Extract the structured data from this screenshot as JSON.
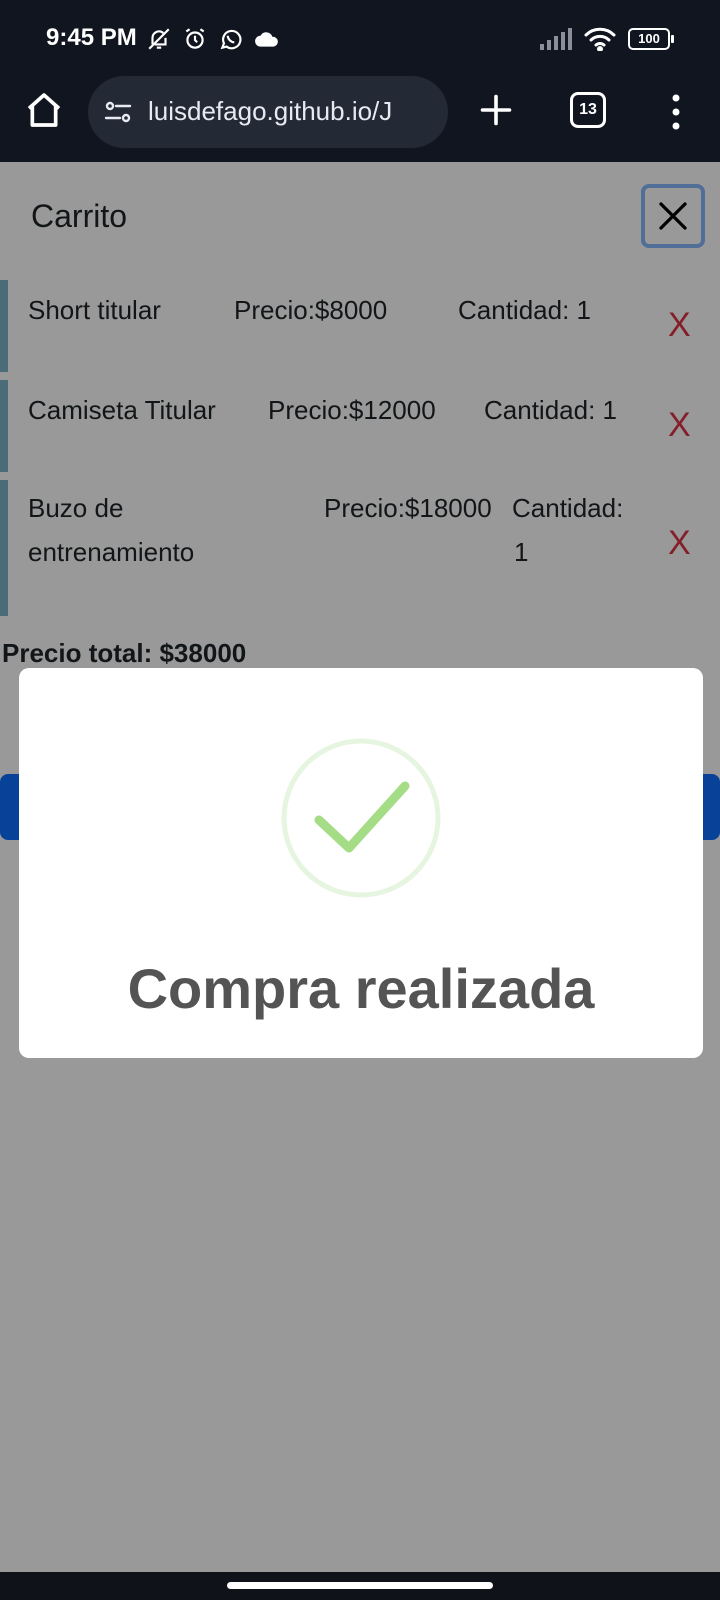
{
  "status_bar": {
    "time": "9:45 PM",
    "left_icons": [
      "bell-off-icon",
      "alarm-icon",
      "whatsapp-icon",
      "cloud-icon"
    ],
    "right_icons": [
      "signal-icon",
      "wifi-icon"
    ],
    "battery": "100"
  },
  "browser": {
    "url": "luisdefago.github.io/J",
    "tab_count": "13",
    "icons": [
      "home-icon",
      "site-settings-icon",
      "plus-icon",
      "tabs-icon",
      "more-vert-icon"
    ]
  },
  "cart": {
    "title": "Carrito",
    "close_icon": "close-icon",
    "items": [
      {
        "name": "Short titular",
        "price": "Precio:$8000",
        "quantity": "Cantidad: 1",
        "remove": "X"
      },
      {
        "name": "Camiseta Titular",
        "price": "Precio:$12000",
        "quantity": "Cantidad: 1",
        "remove": "X"
      },
      {
        "name_line1": "Buzo de",
        "name_line2": "entrenamiento",
        "price": "Precio:$18000",
        "quantity_line1": "Cantidad:",
        "quantity_line2": "1",
        "remove": "X"
      }
    ],
    "total": "Precio total: $38000"
  },
  "dialog": {
    "title": "Compra realizada",
    "icon": "success-check-icon"
  },
  "colors": {
    "primary_button": "#0d6efd",
    "remove": "#dc3545",
    "success": "#a5dc86",
    "overlay": "rgba(0,0,0,0.4)"
  }
}
